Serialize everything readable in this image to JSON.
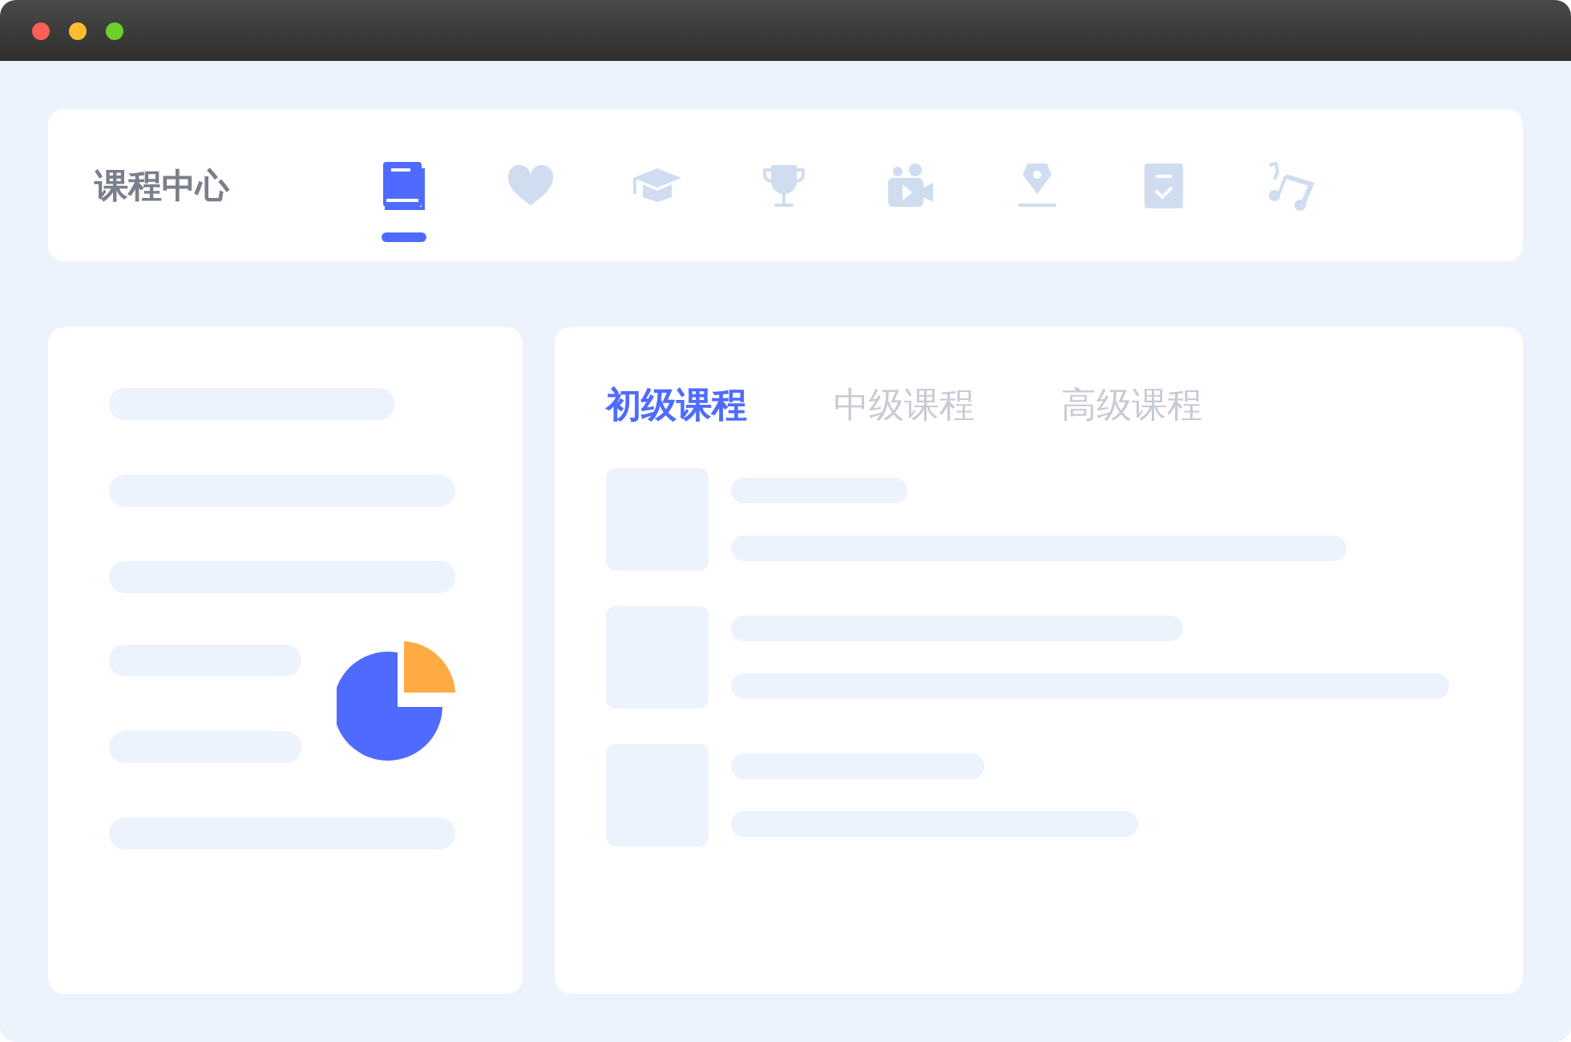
{
  "header": {
    "title": "课程中心"
  },
  "icon_tabs": [
    {
      "kind": "book",
      "selected": true
    },
    {
      "kind": "heart",
      "selected": false
    },
    {
      "kind": "cap",
      "selected": false
    },
    {
      "kind": "trophy",
      "selected": false
    },
    {
      "kind": "video",
      "selected": false
    },
    {
      "kind": "pen",
      "selected": false
    },
    {
      "kind": "checklist",
      "selected": false
    },
    {
      "kind": "music",
      "selected": false
    }
  ],
  "course_tabs": [
    {
      "label": "初级课程",
      "selected": true
    },
    {
      "label": "中级课程",
      "selected": false
    },
    {
      "label": "高级课程",
      "selected": false
    }
  ]
}
